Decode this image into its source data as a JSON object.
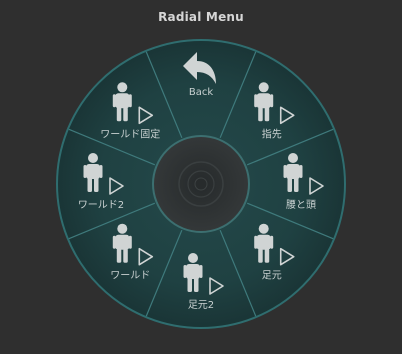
{
  "window": {
    "title": "Radial Menu"
  },
  "menu": {
    "items": [
      {
        "id": "back",
        "label": "Back",
        "icon": "back-arrow-icon"
      },
      {
        "id": "fingertip",
        "label": "指先",
        "icon": "person-icon"
      },
      {
        "id": "waist-head",
        "label": "腰と頭",
        "icon": "person-icon"
      },
      {
        "id": "foot",
        "label": "足元",
        "icon": "person-icon"
      },
      {
        "id": "foot2",
        "label": "足元2",
        "icon": "person-icon"
      },
      {
        "id": "world",
        "label": "ワールド",
        "icon": "person-icon"
      },
      {
        "id": "world2",
        "label": "ワールド2",
        "icon": "person-icon"
      },
      {
        "id": "world-fixed",
        "label": "ワールド固定",
        "icon": "person-icon"
      }
    ]
  },
  "colors": {
    "background": "#2f2f2f",
    "ring_fill": "#1c3a3b",
    "ring_border": "#2f6d6f",
    "divider": "#3f7a7c",
    "center_fill": "#2b2f30",
    "icon": "#d0d4d4"
  }
}
